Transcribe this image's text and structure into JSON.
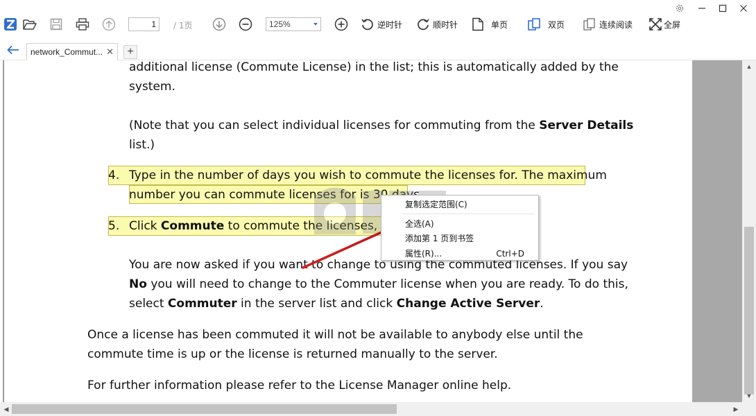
{
  "toolbar": {
    "page_current": "1",
    "page_total": "/ 1页",
    "zoom": "125%",
    "rotate_ccw": "逆时针",
    "rotate_cw": "顺时针",
    "single_page": "单页",
    "double_page": "双页",
    "continuous": "连续阅读",
    "fullscreen": "全屏"
  },
  "tabs": {
    "active": "network_Commut...",
    "close": "✕",
    "add": "+"
  },
  "document": {
    "p1_line1": "additional license (Commute License) in the list; this is automatically added by the",
    "p1_line2": "system.",
    "p2_line1_a": "(Note that you can select individual licenses for commuting from the ",
    "p2_line1_b": "Server Details",
    "p2_line2": "list.)",
    "item4_num": "4.",
    "item4_line1": "Type in the number of days you wish to commute the licenses for. The maximum",
    "item4_line2": "number you can commute licenses for is 30 days.",
    "item5_num": "5.",
    "item5_a": "Click ",
    "item5_b": "Commute",
    "item5_c": " to commute the licenses, following",
    "p3_line1": "You are now asked if you want to change to using the commuted licenses. If you say",
    "p3_line2_a": "No",
    "p3_line2_b": " you will need to change to the Commuter license when you are ready.  To do this,",
    "p3_line3_a": "select ",
    "p3_line3_b": "Commuter",
    "p3_line3_c": " in the server list and click ",
    "p3_line3_d": "Change Active Server",
    "p3_line3_e": ".",
    "p4_line1": "Once a license has been commuted it will not be available to anybody else until the",
    "p4_line2": "commute time is up or the license is returned manually to the server.",
    "p5_line1": "For further information please refer to the License Manager online help."
  },
  "context_menu": {
    "copy_selection": "复制选定范围(C)",
    "select_all": "全选(A)",
    "add_bookmark": "添加第 1 页到书签",
    "properties": "属性(R)...",
    "properties_shortcut": "Ctrl+D"
  },
  "colors": {
    "highlight_fill": "#fbfbb0",
    "highlight_border": "#c7b84a",
    "arrow": "#d42020",
    "accent_blue": "#2f6fce"
  }
}
